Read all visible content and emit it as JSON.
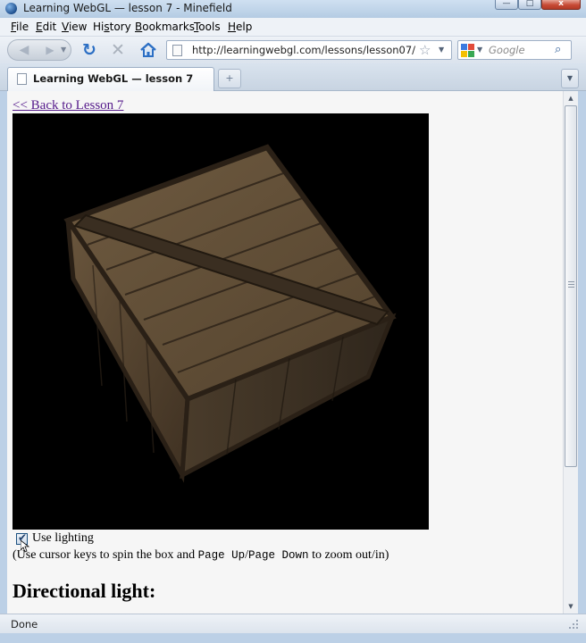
{
  "window": {
    "title": "Learning WebGL — lesson 7 - Minefield",
    "minimize_glyph": "—",
    "maximize_glyph": "□",
    "close_glyph": "x"
  },
  "menu": {
    "items": [
      {
        "mnemonic": "F",
        "rest": "ile"
      },
      {
        "mnemonic": "E",
        "rest": "dit"
      },
      {
        "mnemonic": "V",
        "rest": "iew"
      },
      {
        "pre": "Hi",
        "mnemonic": "s",
        "rest": "tory"
      },
      {
        "mnemonic": "B",
        "rest": "ookmarks"
      },
      {
        "mnemonic": "T",
        "rest": "ools"
      },
      {
        "mnemonic": "H",
        "rest": "elp"
      }
    ]
  },
  "navbar": {
    "back_glyph": "◀",
    "forward_glyph": "▶",
    "dropdown_glyph": "▼",
    "reload_glyph": "↻",
    "stop_glyph": "✕",
    "url": "http://learningwebgl.com/lessons/lesson07/",
    "star_glyph": "☆",
    "search_placeholder": "Google",
    "search_glyph": "⌕"
  },
  "tabs": {
    "active_label": "Learning WebGL — lesson 7",
    "newtab_glyph": "+",
    "alltabs_glyph": "▼"
  },
  "page": {
    "back_link": "<< Back to Lesson 7",
    "lighting_label": "Use lighting",
    "lighting_checked": true,
    "check_glyph": "✔",
    "instructions_pre": "(Use cursor keys to spin the box and ",
    "instructions_code1": "Page Up",
    "instructions_sep": "/",
    "instructions_code2": "Page Down",
    "instructions_post": " to zoom out/in)",
    "heading": "Directional light:"
  },
  "scrollbar": {
    "up_glyph": "▲",
    "down_glyph": "▼"
  },
  "status": {
    "text": "Done"
  },
  "colors": {
    "link_visited": "#551a8b",
    "canvas_background": "#000000",
    "crate_wood": "#5a4630"
  }
}
